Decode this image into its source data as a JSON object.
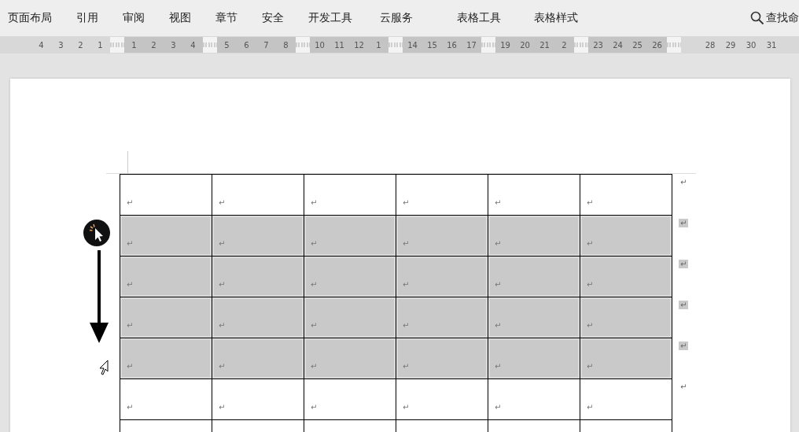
{
  "menu": [
    {
      "label": "页面布局"
    },
    {
      "label": "引用"
    },
    {
      "label": "审阅"
    },
    {
      "label": "视图"
    },
    {
      "label": "章节"
    },
    {
      "label": "安全"
    },
    {
      "label": "开发工具"
    },
    {
      "label": "云服务"
    },
    {
      "label": "表格工具"
    },
    {
      "label": "表格样式"
    }
  ],
  "search": {
    "label": "查找命"
  },
  "ruler": [
    {
      "kind": "margin",
      "labels": [
        "4",
        "3",
        "2",
        "1"
      ]
    },
    {
      "kind": "marker"
    },
    {
      "kind": "column",
      "labels": [
        "1",
        "2",
        "3",
        "4"
      ]
    },
    {
      "kind": "marker"
    },
    {
      "kind": "column",
      "labels": [
        "5",
        "6",
        "7",
        "8"
      ]
    },
    {
      "kind": "marker"
    },
    {
      "kind": "column",
      "labels": [
        "10",
        "11",
        "12",
        "1"
      ]
    },
    {
      "kind": "marker"
    },
    {
      "kind": "column",
      "labels": [
        "14",
        "15",
        "16",
        "17"
      ]
    },
    {
      "kind": "marker"
    },
    {
      "kind": "column",
      "labels": [
        "19",
        "20",
        "21",
        "2"
      ]
    },
    {
      "kind": "marker"
    },
    {
      "kind": "column",
      "labels": [
        "23",
        "24",
        "25",
        "26"
      ]
    },
    {
      "kind": "marker"
    },
    {
      "kind": "margin",
      "labels": [
        "28",
        "29",
        "30",
        "31"
      ]
    }
  ],
  "table": {
    "rows": [
      {
        "selected": false,
        "cells": [
          "↵",
          "↵",
          "↵",
          "↵",
          "↵",
          "↵"
        ],
        "end_mark": "↵"
      },
      {
        "selected": true,
        "cells": [
          "↵",
          "↵",
          "↵",
          "↵",
          "↵",
          "↵"
        ],
        "end_mark": "↵"
      },
      {
        "selected": true,
        "cells": [
          "↵",
          "↵",
          "↵",
          "↵",
          "↵",
          "↵"
        ],
        "end_mark": "↵"
      },
      {
        "selected": true,
        "cells": [
          "↵",
          "↵",
          "↵",
          "↵",
          "↵",
          "↵"
        ],
        "end_mark": "↵"
      },
      {
        "selected": true,
        "cells": [
          "↵",
          "↵",
          "↵",
          "↵",
          "↵",
          "↵"
        ],
        "end_mark": "↵"
      },
      {
        "selected": false,
        "cells": [
          "↵",
          "↵",
          "↵",
          "↵",
          "↵",
          "↵"
        ],
        "end_mark": "↵"
      }
    ]
  }
}
